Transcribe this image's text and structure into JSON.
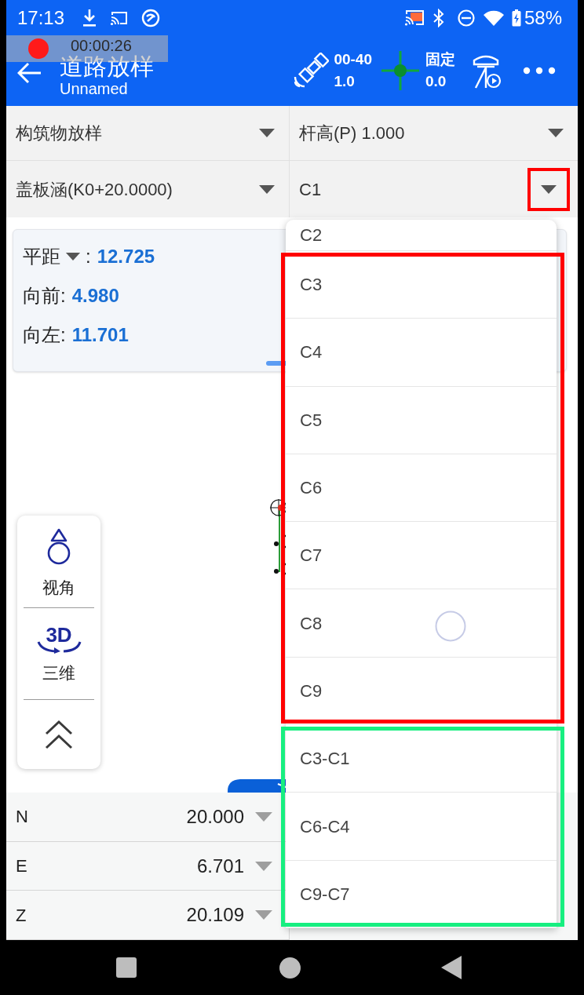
{
  "status_bar": {
    "time": "17:13",
    "battery": "58%"
  },
  "recorder": {
    "timer": "00:00:26"
  },
  "header": {
    "title": "道路放样",
    "subtitle": "Unnamed",
    "satellites": {
      "line_1": "00-40",
      "line_2": "1.0"
    },
    "solution": {
      "line_1": "固定",
      "line_2": "0.0"
    }
  },
  "selectors": [
    {
      "value": "构筑物放样",
      "highlighted": false
    },
    {
      "value": "杆高(P) 1.000",
      "highlighted": false
    },
    {
      "value": "盖板涵(K0+20.0000)",
      "highlighted": false
    },
    {
      "value": "C1",
      "highlighted": true
    }
  ],
  "info_card": {
    "rows": [
      {
        "kind": "dropdown",
        "label": "平距",
        "separator": ":",
        "value": "12.725"
      },
      {
        "kind": "plain",
        "label": "向前:",
        "value": "4.980"
      },
      {
        "kind": "plain",
        "label": "向左:",
        "value": "11.701"
      }
    ]
  },
  "view_tools": [
    {
      "kind": "view",
      "label": "视角"
    },
    {
      "kind": "rotate",
      "icon_text": "3D",
      "label": "三维"
    },
    {
      "kind": "collapse"
    }
  ],
  "coordinates": [
    {
      "axis": "N",
      "value": "20.000"
    },
    {
      "axis": "E",
      "value": "6.701"
    },
    {
      "axis": "Z",
      "value": "20.109"
    }
  ],
  "dropdown_menu": {
    "loading": true,
    "groups": [
      {
        "items": [
          "C2"
        ]
      },
      {
        "color": "#ff0000",
        "items": [
          "C3",
          "C4",
          "C5",
          "C6",
          "C7",
          "C8",
          "C9"
        ]
      },
      {
        "color": "#17ef80",
        "items": [
          "C3-C1",
          "C6-C4",
          "C9-C7"
        ]
      }
    ]
  }
}
